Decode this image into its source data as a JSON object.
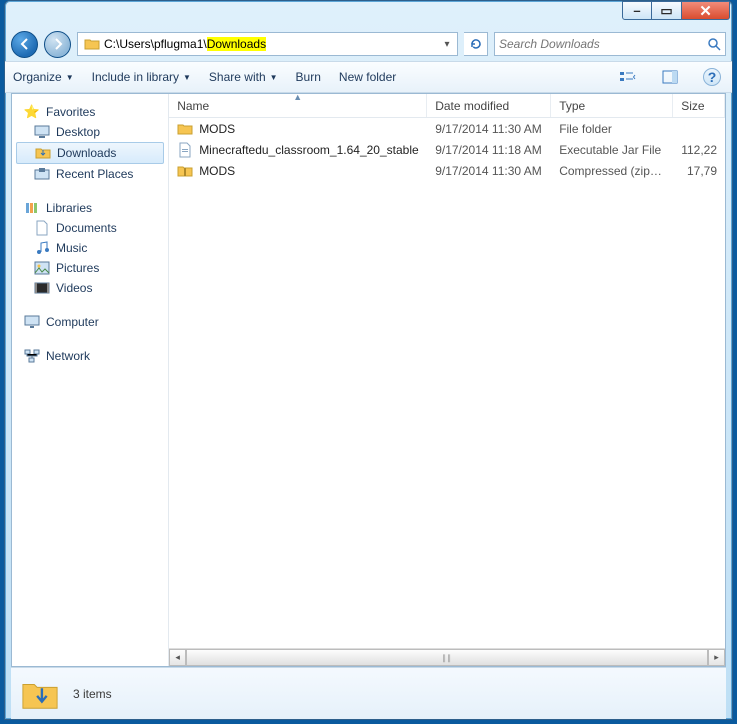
{
  "titlebar": {
    "min_label": "–",
    "max_label": "▭",
    "close_label": "✕"
  },
  "address": {
    "path_prefix": "C:\\Users\\pflugma1\\",
    "path_highlight": "Downloads"
  },
  "search": {
    "placeholder": "Search Downloads"
  },
  "toolbar": {
    "organize": "Organize",
    "include": "Include in library",
    "share": "Share with",
    "burn": "Burn",
    "newfolder": "New folder"
  },
  "nav": {
    "favorites": "Favorites",
    "desktop": "Desktop",
    "downloads": "Downloads",
    "recent": "Recent Places",
    "libraries": "Libraries",
    "documents": "Documents",
    "music": "Music",
    "pictures": "Pictures",
    "videos": "Videos",
    "computer": "Computer",
    "network": "Network"
  },
  "columns": {
    "name": "Name",
    "date": "Date modified",
    "type": "Type",
    "size": "Size"
  },
  "files": [
    {
      "name": "MODS",
      "date": "9/17/2014 11:30 AM",
      "type": "File folder",
      "size": "",
      "icon": "folder"
    },
    {
      "name": "Minecraftedu_classroom_1.64_20_stable",
      "date": "9/17/2014 11:18 AM",
      "type": "Executable Jar File",
      "size": "112,22",
      "icon": "jar"
    },
    {
      "name": "MODS",
      "date": "9/17/2014 11:30 AM",
      "type": "Compressed (zipp...",
      "size": "17,79",
      "icon": "zip"
    }
  ],
  "details": {
    "summary": "3 items"
  }
}
